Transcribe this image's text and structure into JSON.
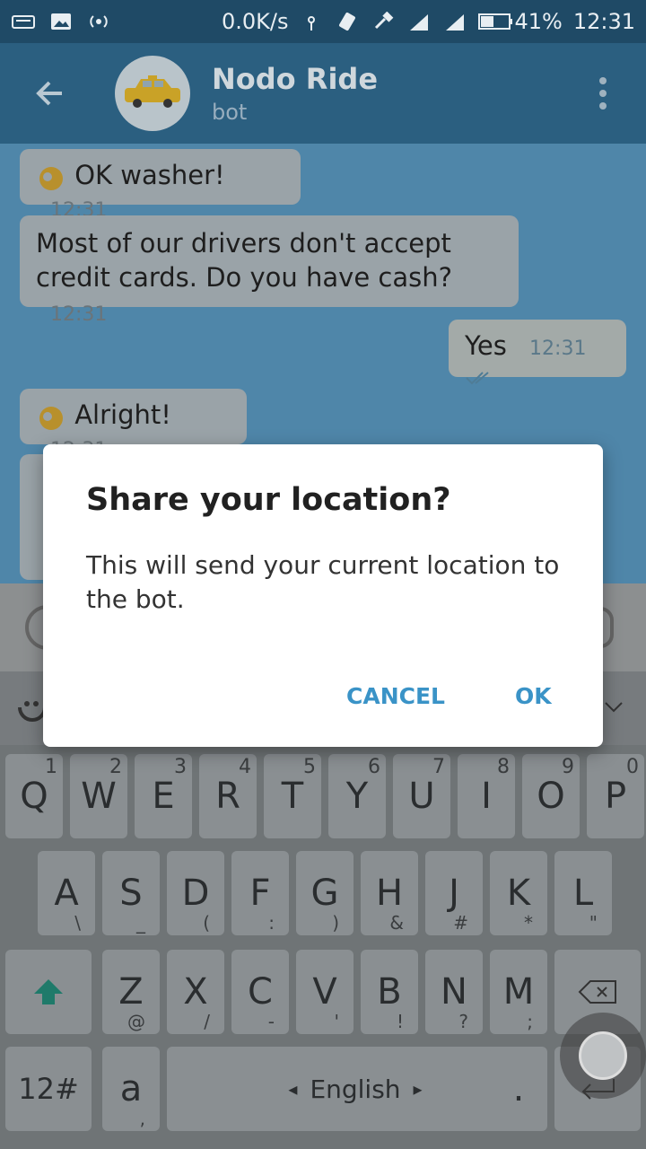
{
  "status": {
    "speed": "0.0K/s",
    "battery": "41%",
    "time": "12:31"
  },
  "header": {
    "name": "Nodo Ride",
    "subtitle": "bot"
  },
  "messages": [
    {
      "text": "OK washer!",
      "time": "12:31",
      "emoji": true
    },
    {
      "text1": "Most of our drivers don't accept",
      "text2": "credit cards. Do you have cash?",
      "time": "12:31"
    },
    {
      "text": "Yes",
      "time": "12:31"
    },
    {
      "text": "Alright!",
      "time": "12:31",
      "emoji": true
    }
  ],
  "dialog": {
    "title": "Share your location?",
    "body": "This will send your current location to the bot.",
    "cancel": "CANCEL",
    "ok": "OK"
  },
  "keyboard": {
    "row1": [
      [
        "Q",
        "1"
      ],
      [
        "W",
        "2"
      ],
      [
        "E",
        "3"
      ],
      [
        "R",
        "4"
      ],
      [
        "T",
        "5"
      ],
      [
        "Y",
        "6"
      ],
      [
        "U",
        "7"
      ],
      [
        "I",
        "8"
      ],
      [
        "O",
        "9"
      ],
      [
        "P",
        "0"
      ]
    ],
    "row2": [
      [
        "A",
        "\\"
      ],
      [
        "S",
        "_"
      ],
      [
        "D",
        "("
      ],
      [
        "F",
        ":"
      ],
      [
        "G",
        ")"
      ],
      [
        "H",
        "&"
      ],
      [
        "J",
        "#"
      ],
      [
        "K",
        "*"
      ],
      [
        "L",
        "\""
      ]
    ],
    "row3": [
      [
        "Z",
        "@"
      ],
      [
        "X",
        "/"
      ],
      [
        "C",
        "-"
      ],
      [
        "V",
        "'"
      ],
      [
        "B",
        "!"
      ],
      [
        "N",
        "?"
      ],
      [
        "M",
        ";"
      ]
    ],
    "num_key": "12#",
    "space_label": "English",
    "period": ".",
    "comma": ","
  }
}
